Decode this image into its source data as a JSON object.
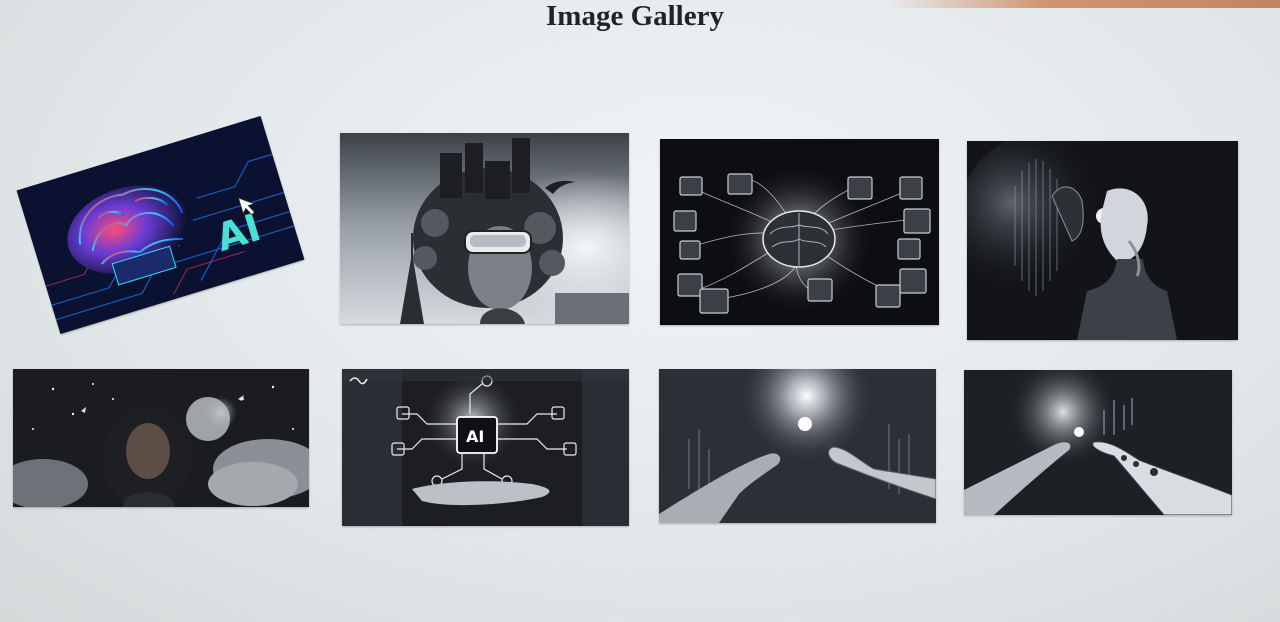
{
  "page": {
    "title": "Image Gallery"
  },
  "gallery": {
    "images": [
      {
        "id": "img-1",
        "subject": "colorful AI brain on circuit board",
        "overlay_text": "AI",
        "tone": "color"
      },
      {
        "id": "img-2",
        "subject": "woman wearing VR headset with city on her head",
        "tone": "grayscale"
      },
      {
        "id": "img-3",
        "subject": "glowing brain with connected picture frames",
        "tone": "grayscale"
      },
      {
        "id": "img-4",
        "subject": "robot head in profile",
        "tone": "grayscale"
      },
      {
        "id": "img-5",
        "subject": "girl under moonlit night sky",
        "tone": "grayscale"
      },
      {
        "id": "img-6",
        "subject": "hand holding AI chip circuit",
        "overlay_text": "AI",
        "tone": "grayscale"
      },
      {
        "id": "img-7",
        "subject": "human and robot hands reaching toward light",
        "tone": "grayscale"
      },
      {
        "id": "img-8",
        "subject": "robot hand touching human hand",
        "tone": "grayscale"
      }
    ]
  },
  "colors": {
    "page_background": "#e6eaec",
    "title_text": "#202428",
    "ai_teal": "#4be0d4",
    "ai_magenta": "#e0335f",
    "tile_dark": "#16181d"
  }
}
